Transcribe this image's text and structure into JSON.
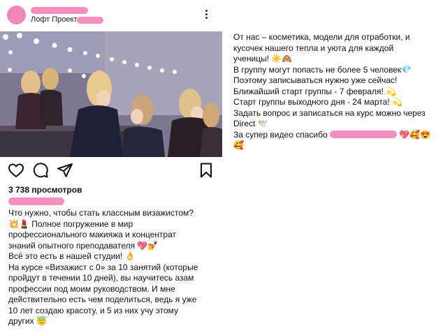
{
  "post": {
    "location": "Лофт Проект",
    "views": "3 738 просмотров",
    "caption_lines": [
      "Что нужно, чтобы стать классным визажистом?",
      "💥💄 Полное погружение в мир",
      "профессионального макияжа и концентрат",
      "знаний опытного преподавателя 💖💅",
      "Всё это есть в нашей студии! 👌",
      "На курсе «Визажист с 0» за 10 занятий (которые",
      "пройдут в течении 10 дней), вы научитесь азам",
      "профессии под моим руководством. И мне",
      "действительно есть чем поделиться, ведь я уже",
      "10 лет создаю красоту, и 5 из них учу этому",
      "других 😇"
    ]
  },
  "description": {
    "lines": [
      "От нас – косметика, модели для отработки, и",
      "кусочек нашего тепла и уюта для каждой",
      "ученицы! ☀️🙈",
      "В группу могут попасть не более 5 человек💎",
      "Поэтому записываться нужно уже сейчас!",
      "Ближайший старт группы - 7 февраля! 💫",
      "Старт группы выходного дня - 24 марта! 💫",
      "Задать вопрос и записаться на курс можно через",
      "Direct 🕊️"
    ],
    "thanks_prefix": "За супер видео спасибо",
    "thanks_suffix": "💖🥰😍",
    "last_emoji": "🥰"
  },
  "icons": {
    "like": "heart-icon",
    "comment": "comment-icon",
    "share": "share-icon",
    "save": "bookmark-icon",
    "more": "more-vertical-icon"
  },
  "colors": {
    "redaction": "#f48fbf",
    "text": "#111111"
  }
}
